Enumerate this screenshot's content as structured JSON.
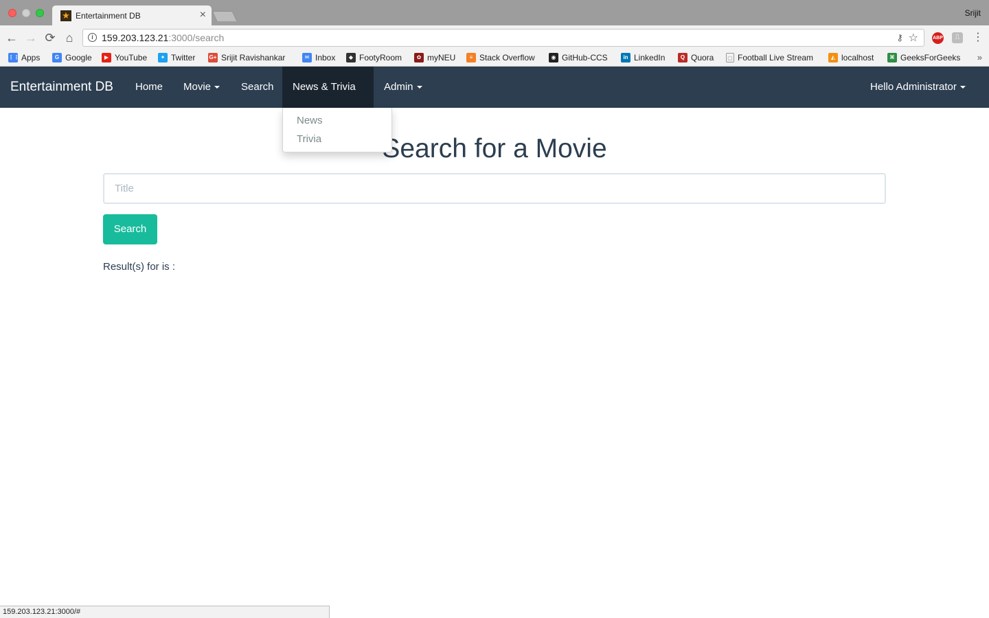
{
  "browser": {
    "tab_title": "Entertainment DB",
    "tab_close": "×",
    "profile_name": "Srijit",
    "url_host": "159.203.123.21",
    "url_path": ":3000/search",
    "back_glyph": "←",
    "forward_glyph": "→",
    "reload_glyph": "⟳",
    "home_glyph": "⌂",
    "abp_label": "ABP",
    "menu_glyph": "⋮",
    "bookmarks": [
      {
        "label": "Apps",
        "icon": "apps-grid-icon",
        "color": "#4285f4"
      },
      {
        "label": "Google",
        "icon": "google-icon",
        "color": "#4285f4"
      },
      {
        "label": "YouTube",
        "icon": "youtube-icon",
        "color": "#e62117"
      },
      {
        "label": "Twitter",
        "icon": "twitter-icon",
        "color": "#1da1f2"
      },
      {
        "label": "Srijit Ravishankar",
        "icon": "google-plus-icon",
        "color": "#dd4b39"
      },
      {
        "label": "Inbox",
        "icon": "inbox-icon",
        "color": "#4285f4"
      },
      {
        "label": "FootyRoom",
        "icon": "footyroom-icon",
        "color": "#333333"
      },
      {
        "label": "myNEU",
        "icon": "paw-icon",
        "color": "#8b1a1a"
      },
      {
        "label": "Stack Overflow",
        "icon": "stackoverflow-icon",
        "color": "#f48024"
      },
      {
        "label": "GitHub-CCS",
        "icon": "github-icon",
        "color": "#222222"
      },
      {
        "label": "LinkedIn",
        "icon": "linkedin-icon",
        "color": "#0077b5"
      },
      {
        "label": "Quora",
        "icon": "quora-icon",
        "color": "#b92b27"
      },
      {
        "label": "Football Live Stream",
        "icon": "page-icon",
        "color": "#9a9a9a"
      },
      {
        "label": "localhost",
        "icon": "pma-icon",
        "color": "#f29111"
      },
      {
        "label": "GeeksForGeeks",
        "icon": "geeksforgeeks-icon",
        "color": "#2f8d46"
      }
    ],
    "bookmarks_more": "»",
    "status_url": "159.203.123.21:3000/#"
  },
  "navbar": {
    "brand": "Entertainment DB",
    "items": [
      {
        "label": "Home",
        "dropdown": false
      },
      {
        "label": "Movie",
        "dropdown": true
      },
      {
        "label": "Search",
        "dropdown": false
      },
      {
        "label": "News & Trivia",
        "dropdown": true
      },
      {
        "label": "Admin",
        "dropdown": true
      }
    ],
    "user_menu": "Hello Administrator",
    "open_dropdown": {
      "items": [
        "News",
        "Trivia"
      ]
    },
    "colors": {
      "bg": "#2c3e50",
      "active": "#1a242f"
    }
  },
  "main": {
    "title": "Search for a Movie",
    "search_input": {
      "placeholder": "Title",
      "value": ""
    },
    "search_button": "Search",
    "result_text": "Result(s) for is :",
    "accent": "#18bc9c"
  }
}
